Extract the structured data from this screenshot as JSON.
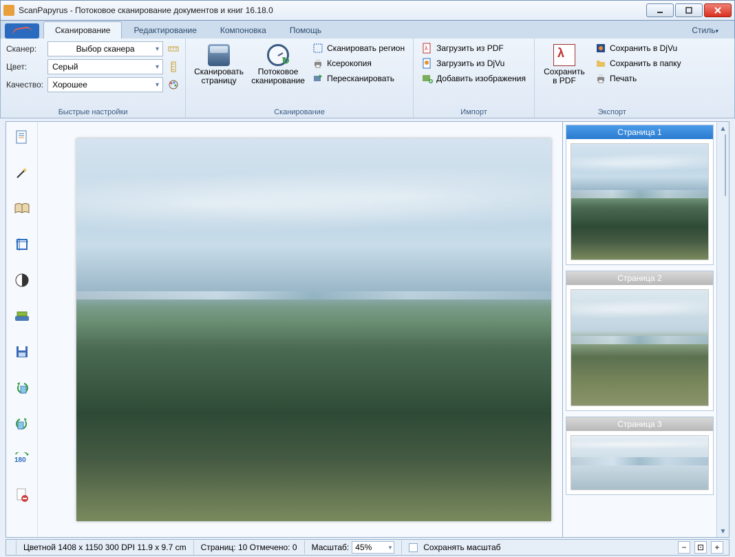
{
  "app": {
    "title": "ScanPapyrus - Потоковое сканирование документов и книг 16.18.0"
  },
  "tabs": {
    "scan": "Сканирование",
    "edit": "Редактирование",
    "layout": "Компоновка",
    "help": "Помощь",
    "style": "Стиль"
  },
  "settings": {
    "scanner_label": "Сканер:",
    "scanner_value": "Выбор сканера",
    "color_label": "Цвет:",
    "color_value": "Серый",
    "quality_label": "Качество:",
    "quality_value": "Хорошее",
    "group_title": "Быстрые настройки"
  },
  "scan_group": {
    "scan_page": "Сканировать страницу",
    "stream_scan": "Потоковое сканирование",
    "scan_region": "Сканировать регион",
    "photocopy": "Ксерокопия",
    "rescan": "Пересканировать",
    "title": "Сканирование"
  },
  "import_group": {
    "load_pdf": "Загрузить из PDF",
    "load_djvu": "Загрузить из DjVu",
    "add_images": "Добавить изображения",
    "title": "Импорт"
  },
  "export_group": {
    "save_pdf": "Сохранить в PDF",
    "save_djvu": "Сохранить в DjVu",
    "save_folder": "Сохранить в папку",
    "print": "Печать",
    "title": "Экспорт"
  },
  "thumbs": {
    "p1": "Страница 1",
    "p2": "Страница 2",
    "p3": "Страница 3"
  },
  "status": {
    "info": "Цветной  1408 x 1150  300 DPI  11.9 x 9.7 cm",
    "pages": "Страниц: 10 Отмечено: 0",
    "zoom_label": "Масштаб:",
    "zoom_value": "45%",
    "keep_zoom": "Сохранять масштаб"
  }
}
